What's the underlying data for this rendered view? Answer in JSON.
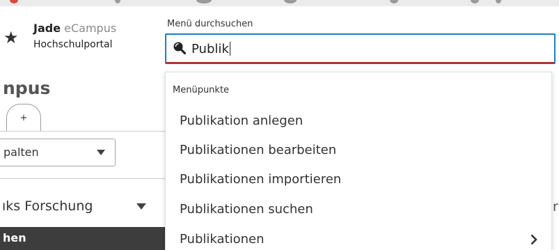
{
  "header": {
    "brand_bold": "Jade",
    "brand_light": " eCampus",
    "brand_sub": "Hochschulportal",
    "logo_icon": "star-icon"
  },
  "search": {
    "label": "Menü durchsuchen",
    "value": "Publik",
    "icon": "search-icon",
    "border_color": "#1e7fc2",
    "underline_color": "#b33232"
  },
  "left_panel": {
    "title": "npus",
    "add_tab_label": "+",
    "select_value": "palten",
    "section_heading": "ıks Forschung",
    "active_item": "hen"
  },
  "right_peek": "r",
  "dropdown": {
    "group_label": "Menüpunkte",
    "items": [
      {
        "label": "Publikation anlegen"
      },
      {
        "label": "Publikationen bearbeiten"
      },
      {
        "label": "Publikationen importieren"
      },
      {
        "label": "Publikationen suchen"
      },
      {
        "label": "Publikationen",
        "has_submenu": true
      }
    ]
  },
  "colors": {
    "active_background": "#3d3d3d",
    "text": "#333333"
  }
}
